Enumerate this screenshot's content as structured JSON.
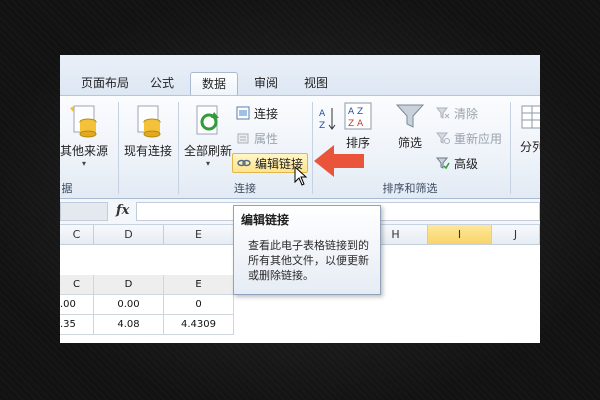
{
  "tabs": [
    "页面布局",
    "公式",
    "数据",
    "审阅",
    "视图"
  ],
  "active_tab": "数据",
  "ribbon": {
    "get_external": {
      "other_sources": "其他来源",
      "existing_connections": "现有连接",
      "group_label": "据"
    },
    "connections": {
      "refresh_all": "全部刷新",
      "connections": "连接",
      "properties": "属性",
      "edit_links": "编辑链接",
      "group_label": "连接"
    },
    "sort_filter": {
      "sort": "排序",
      "filter": "筛选",
      "clear": "清除",
      "reapply": "重新应用",
      "advanced": "高级",
      "group_label": "排序和筛选"
    },
    "data_tools": {
      "split": "分列"
    }
  },
  "formula_bar": {
    "fx": "fx",
    "value": ""
  },
  "columns": [
    "C",
    "D",
    "E",
    "H",
    "I",
    "J"
  ],
  "selected_column": "I",
  "table": {
    "header": [
      "C",
      "D",
      "E"
    ],
    "rows": [
      [
        ".00",
        "0.00",
        "0"
      ],
      [
        ".35",
        "4.08",
        "4.4309"
      ]
    ]
  },
  "tooltip": {
    "title": "编辑链接",
    "body": "查看此电子表格链接到的所有其他文件，以便更新或删除链接。"
  },
  "colors": {
    "accent_arrow": "#e9543b",
    "highlight": "#ffe48a",
    "ribbon": "#eef3f9"
  }
}
